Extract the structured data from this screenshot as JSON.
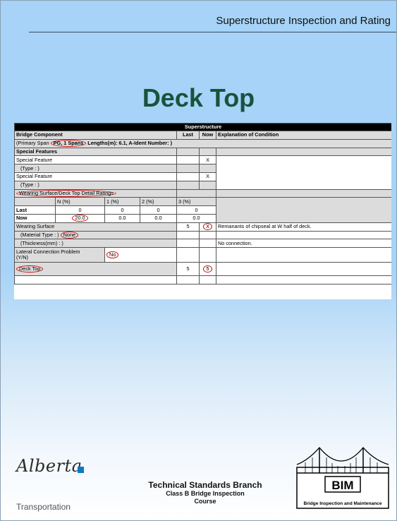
{
  "header": {
    "title": "Superstructure Inspection and Rating"
  },
  "slide": {
    "title": "Deck Top"
  },
  "form": {
    "section": "Superstructure",
    "columns": {
      "component": "Bridge Component",
      "last": "Last",
      "now": "Now",
      "explanation": "Explanation of Condition"
    },
    "primary_span": {
      "prefix": "(Primary Span",
      "circled": "PG, 1 Spans",
      "rest": "Lengths(m): 6.1, A-Ident Number: )"
    },
    "special_features": {
      "heading": "Special Features",
      "rows": [
        {
          "label": "Special Feature",
          "now": "X"
        },
        {
          "label": "(Type : )"
        },
        {
          "label": "Special Feature",
          "now": "X"
        },
        {
          "label": "(Type : )"
        }
      ]
    },
    "wearing_ratings": {
      "heading": "Wearing Surface/Deck Top Detail Ratings",
      "headers": [
        "N (%)",
        "1 (%)",
        "2 (%)",
        "3 (%)"
      ],
      "last": {
        "label": "Last",
        "values": [
          "0",
          "0",
          "0",
          "0"
        ]
      },
      "now": {
        "label": "Now",
        "values": [
          "20.0",
          "0.0",
          "0.0",
          "0.0"
        ]
      }
    },
    "wearing_surface": {
      "label": "Wearing Surface",
      "last": "5",
      "now": "X",
      "explanation": "Remanants of chipseal at W half of deck.",
      "material_label": "(Material Type : )",
      "material_value": "None",
      "thickness_label": "(Thickness(mm) : )",
      "connection_note": "No connection.",
      "lateral_label_1": "Lateral Connection Problem",
      "lateral_label_2": "(Y/N)",
      "lateral_value": "No"
    },
    "deck_top": {
      "label": "Deck Top",
      "last": "5",
      "now": "5"
    }
  },
  "footer": {
    "logo_text": "Alberta",
    "logo_sub": "Transportation",
    "branch_line1": "Technical Standards Branch",
    "branch_line2": "Class B Bridge Inspection",
    "branch_line3": "Course",
    "bim_abbr": "BIM",
    "bim_full": "Bridge Inspection and Maintenance"
  },
  "colors": {
    "background": "#a6d3f7",
    "title": "#18533c",
    "circle": "#d01010",
    "alberta_blue": "#0b7ac2"
  }
}
